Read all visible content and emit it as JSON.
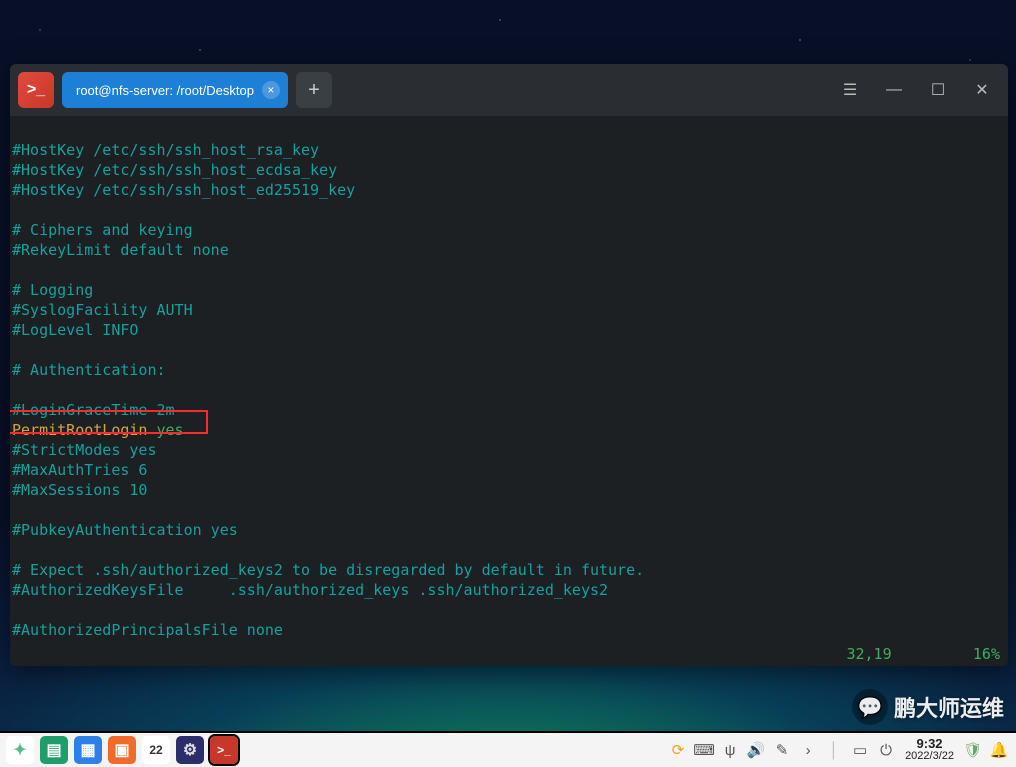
{
  "window": {
    "tab_title": "root@nfs-server: /root/Desktop",
    "app_icon_glyph": ">_"
  },
  "editor": {
    "lines": [
      {
        "type": "blank"
      },
      {
        "type": "comment",
        "text": "#HostKey /etc/ssh/ssh_host_rsa_key"
      },
      {
        "type": "comment",
        "text": "#HostKey /etc/ssh/ssh_host_ecdsa_key"
      },
      {
        "type": "comment",
        "text": "#HostKey /etc/ssh/ssh_host_ed25519_key"
      },
      {
        "type": "blank"
      },
      {
        "type": "comment",
        "text": "# Ciphers and keying"
      },
      {
        "type": "comment",
        "text": "#RekeyLimit default none"
      },
      {
        "type": "blank"
      },
      {
        "type": "comment",
        "text": "# Logging"
      },
      {
        "type": "comment",
        "text": "#SyslogFacility AUTH"
      },
      {
        "type": "comment",
        "text": "#LogLevel INFO"
      },
      {
        "type": "blank"
      },
      {
        "type": "comment",
        "text": "# Authentication:"
      },
      {
        "type": "blank"
      },
      {
        "type": "comment",
        "text": "#LoginGraceTime 2m"
      },
      {
        "type": "kv",
        "key": "PermitRootLogin",
        "val": "yes",
        "highlight": true
      },
      {
        "type": "comment",
        "text": "#StrictModes yes"
      },
      {
        "type": "comment",
        "text": "#MaxAuthTries 6"
      },
      {
        "type": "comment",
        "text": "#MaxSessions 10"
      },
      {
        "type": "blank"
      },
      {
        "type": "comment",
        "text": "#PubkeyAuthentication yes"
      },
      {
        "type": "blank"
      },
      {
        "type": "comment",
        "text": "# Expect .ssh/authorized_keys2 to be disregarded by default in future."
      },
      {
        "type": "comment",
        "text": "#AuthorizedKeysFile     .ssh/authorized_keys .ssh/authorized_keys2"
      },
      {
        "type": "blank"
      },
      {
        "type": "comment",
        "text": "#AuthorizedPrincipalsFile none"
      }
    ],
    "status_pos": "32,19",
    "status_pct": "16%"
  },
  "watermark": {
    "text": "鹏大师运维",
    "icon": "💬"
  },
  "taskbar": {
    "launchers": [
      {
        "name": "launcher-start",
        "glyph": "✦",
        "bg": "#ffffff",
        "fg": "#5b8"
      },
      {
        "name": "launcher-tasks",
        "glyph": "▤",
        "bg": "#1e9e6a",
        "fg": "#fff"
      },
      {
        "name": "launcher-files",
        "glyph": "▦",
        "bg": "#2c80e6",
        "fg": "#fff"
      },
      {
        "name": "launcher-store",
        "glyph": "▣",
        "bg": "#f06a2b",
        "fg": "#fff"
      },
      {
        "name": "launcher-calendar",
        "glyph": "22",
        "bg": "#ffffff",
        "fg": "#333"
      },
      {
        "name": "launcher-settings",
        "glyph": "⚙",
        "bg": "#2b2e6a",
        "fg": "#ddd"
      },
      {
        "name": "launcher-terminal",
        "glyph": ">_",
        "bg": "#c7372a",
        "fg": "#fff",
        "active": true
      }
    ],
    "tray": [
      {
        "name": "tray-update",
        "glyph": "⟳",
        "color": "#f0a020"
      },
      {
        "name": "tray-keyboard",
        "glyph": "⌨",
        "color": "#555"
      },
      {
        "name": "tray-usb",
        "glyph": "ψ",
        "color": "#555"
      },
      {
        "name": "tray-volume",
        "glyph": "🔊",
        "color": "#555"
      },
      {
        "name": "tray-edit",
        "glyph": "✎",
        "color": "#555"
      },
      {
        "name": "tray-more",
        "glyph": "›",
        "color": "#555"
      },
      {
        "name": "tray-divider",
        "glyph": "│",
        "color": "#bbb"
      },
      {
        "name": "tray-desktop",
        "glyph": "▭",
        "color": "#555"
      },
      {
        "name": "tray-power",
        "glyph": "⏻",
        "color": "#555"
      }
    ],
    "clock": {
      "time": "9:32",
      "date": "2022/3/22"
    },
    "right_icons": [
      {
        "name": "tray-shield",
        "glyph": "🛡",
        "color": "#6a6"
      },
      {
        "name": "tray-notify",
        "glyph": "🔔",
        "color": "#555"
      }
    ]
  }
}
